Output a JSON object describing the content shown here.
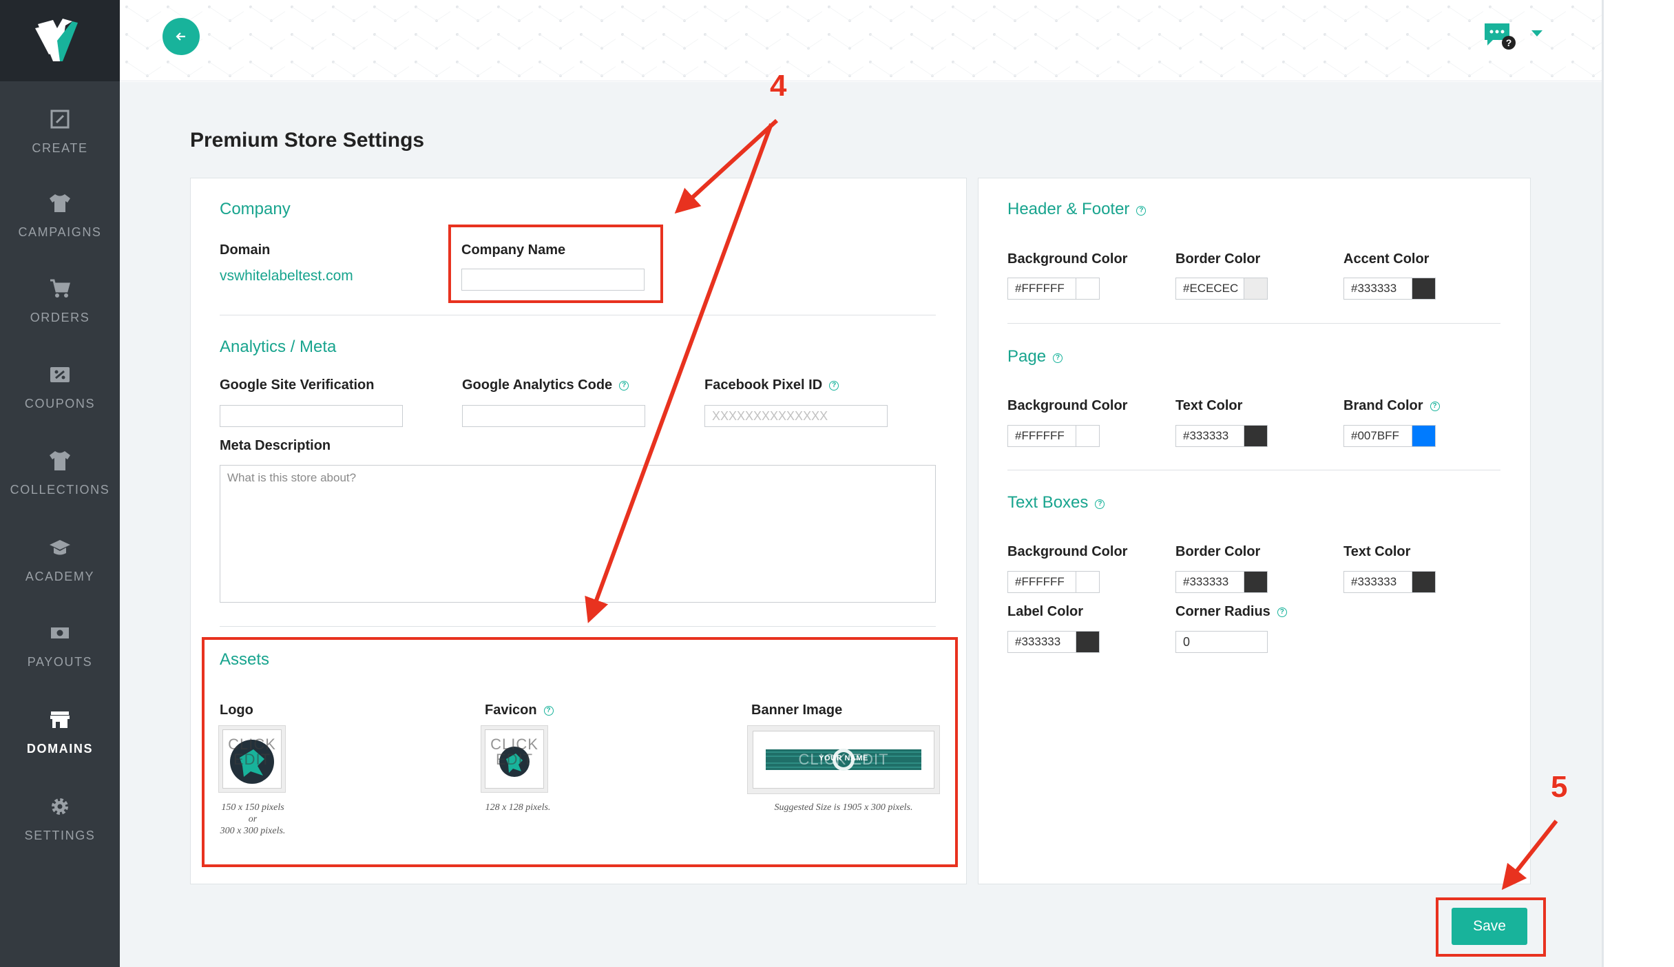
{
  "sidebar": {
    "items": [
      {
        "label": "CREATE",
        "icon": "pencil-square-icon"
      },
      {
        "label": "CAMPAIGNS",
        "icon": "tshirt-icon"
      },
      {
        "label": "ORDERS",
        "icon": "cart-icon"
      },
      {
        "label": "COUPONS",
        "icon": "coupon-icon"
      },
      {
        "label": "COLLECTIONS",
        "icon": "collection-shirt-icon"
      },
      {
        "label": "ACADEMY",
        "icon": "graduation-cap-icon"
      },
      {
        "label": "PAYOUTS",
        "icon": "money-icon"
      },
      {
        "label": "DOMAINS",
        "icon": "store-icon"
      },
      {
        "label": "SETTINGS",
        "icon": "gear-icon"
      }
    ],
    "active": "DOMAINS"
  },
  "page": {
    "title": "Premium Store Settings"
  },
  "company": {
    "title": "Company",
    "domain_label": "Domain",
    "domain_value": "vswhitelabeltest.com",
    "company_name_label": "Company Name",
    "company_name_value": ""
  },
  "analytics": {
    "title": "Analytics / Meta",
    "gsv_label": "Google Site Verification",
    "gsv_value": "",
    "ga_label": "Google Analytics Code",
    "ga_value": "",
    "fb_label": "Facebook Pixel ID",
    "fb_placeholder": "XXXXXXXXXXXXXX",
    "meta_label": "Meta Description",
    "meta_placeholder": "What is this store about?"
  },
  "assets": {
    "title": "Assets",
    "logo_label": "Logo",
    "logo_hint_1": "150 x 150 pixels",
    "logo_hint_or": "or",
    "logo_hint_2": "300 x 300 pixels.",
    "favicon_label": "Favicon",
    "favicon_hint": "128 x 128 pixels.",
    "banner_label": "Banner Image",
    "banner_hint": "Suggested Size is 1905 x 300 pixels.",
    "click": "CLICK",
    "edit": "EDIT",
    "click_edit": "CLICK EDIT",
    "banner_brand": "YOUR NAME"
  },
  "header_footer": {
    "title": "Header & Footer",
    "bg_label": "Background Color",
    "bg_value": "#FFFFFF",
    "border_label": "Border Color",
    "border_value": "#ECECEC",
    "accent_label": "Accent Color",
    "accent_value": "#333333"
  },
  "page_colors": {
    "title": "Page",
    "bg_label": "Background Color",
    "bg_value": "#FFFFFF",
    "text_label": "Text Color",
    "text_value": "#333333",
    "brand_label": "Brand Color",
    "brand_value": "#007BFF"
  },
  "text_boxes": {
    "title": "Text Boxes",
    "bg_label": "Background Color",
    "bg_value": "#FFFFFF",
    "border_label": "Border Color",
    "border_value": "#333333",
    "text_label": "Text Color",
    "text_value": "#333333",
    "label_label": "Label Color",
    "label_value": "#333333",
    "radius_label": "Corner Radius",
    "radius_value": "0"
  },
  "save_label": "Save",
  "annotations": {
    "step4": "4",
    "step5": "5"
  },
  "colors": {
    "accent": "#18B39B",
    "sidebar": "#343A40",
    "annotation": "#E8321F"
  }
}
